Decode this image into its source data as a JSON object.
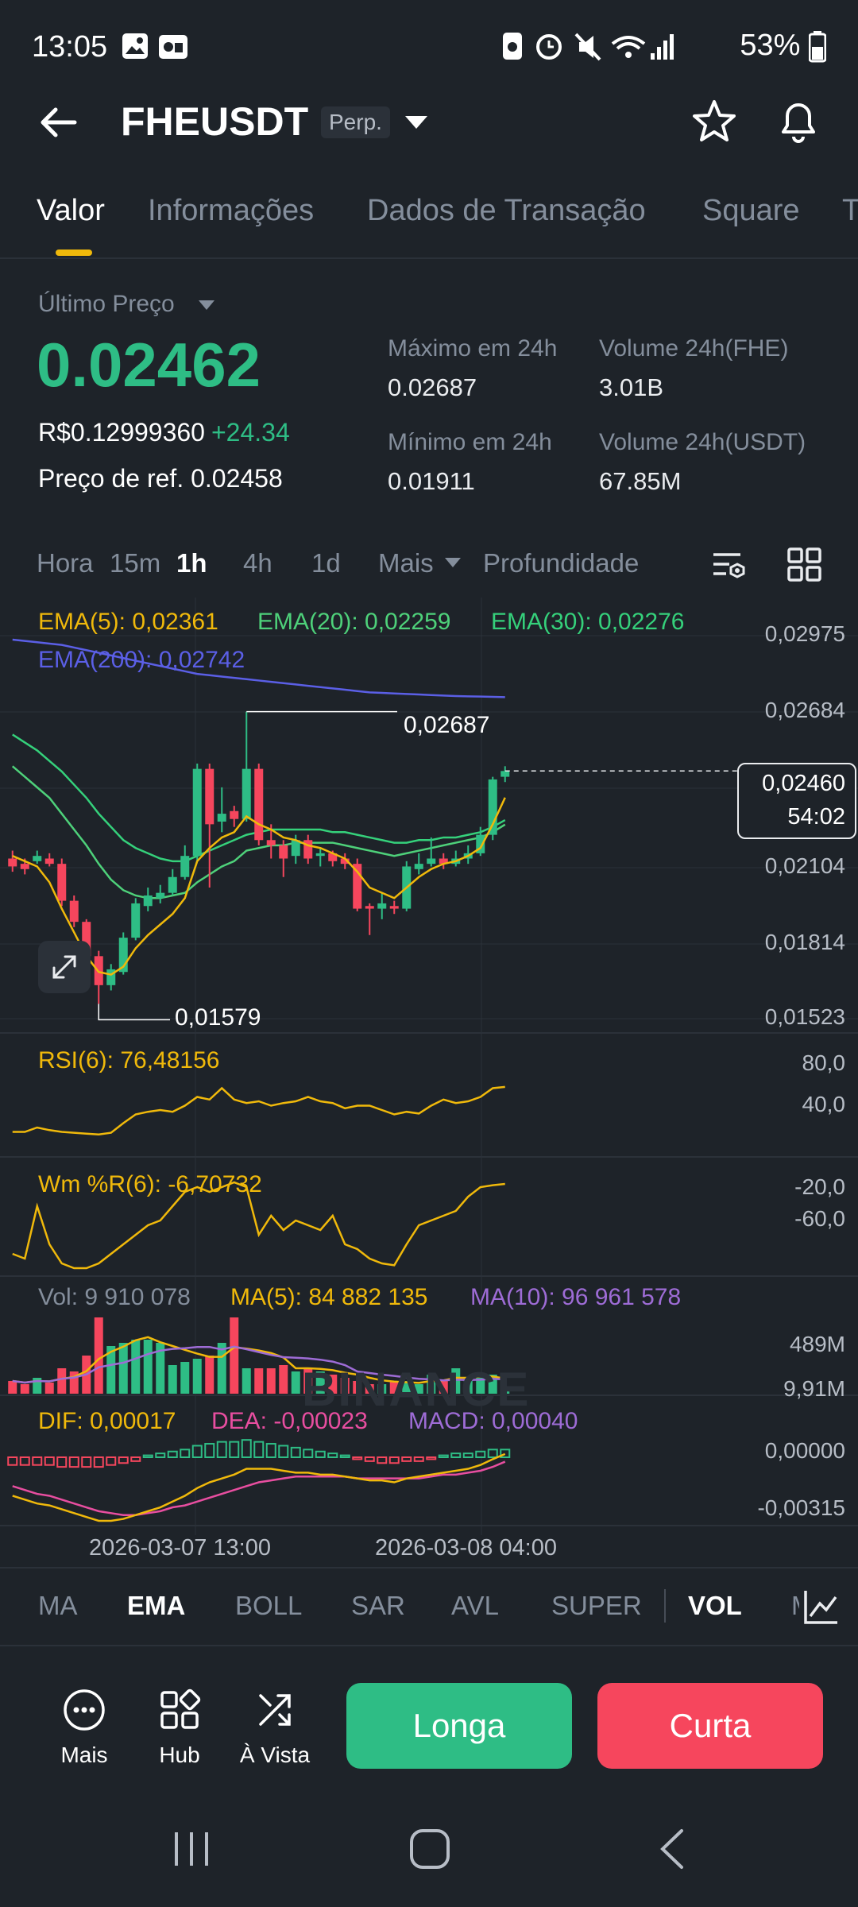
{
  "status_bar": {
    "time": "13:05",
    "battery": "53%"
  },
  "header": {
    "symbol": "FHEUSDT",
    "badge": "Perp."
  },
  "tabs": [
    {
      "label": "Valor"
    },
    {
      "label": "Informações"
    },
    {
      "label": "Dados de Transação"
    },
    {
      "label": "Square"
    },
    {
      "label": "T"
    }
  ],
  "price": {
    "label": "Último Preço",
    "last": "0.02462",
    "fiat": "R$0.12999360",
    "change": "+24.34",
    "ref_label": "Preço de ref.",
    "ref_value": "0.02458"
  },
  "stats": {
    "high_label": "Máximo em 24h",
    "high_value": "0.02687",
    "vol_base_label": "Volume 24h(FHE)",
    "vol_base_value": "3.01B",
    "low_label": "Mínimo em 24h",
    "low_value": "0.01911",
    "vol_quote_label": "Volume 24h(USDT)",
    "vol_quote_value": "67.85M"
  },
  "intervals": [
    {
      "label": "Hora"
    },
    {
      "label": "15m"
    },
    {
      "label": "1h"
    },
    {
      "label": "4h"
    },
    {
      "label": "1d"
    },
    {
      "label": "Mais"
    },
    {
      "label": "Profundidade"
    }
  ],
  "chart": {
    "ema5": "EMA(5): 0,02361",
    "ema20": "EMA(20): 0,02259",
    "ema30": "EMA(30): 0,02276",
    "ema200": "EMA(200): 0,02742",
    "y_labels": [
      "0,02975",
      "0,02684",
      "0,02104",
      "0,01814",
      "0,01523"
    ],
    "high_marker": "0,02687",
    "low_marker": "0,01579",
    "current_price": "0,02460",
    "countdown": "54:02",
    "watermark": "BINANCE",
    "rsi_label": "RSI(6): 76,48156",
    "rsi_axis": [
      "80,0",
      "40,0"
    ],
    "wr_label": "Wm %R(6): -6,70732",
    "wr_axis": [
      "-20,0",
      "-60,0"
    ],
    "vol_label": "Vol: 9 910 078",
    "vol_ma5": "MA(5): 84 882 135",
    "vol_ma10": "MA(10): 96 961 578",
    "vol_axis": [
      "489M",
      "9,91M"
    ],
    "dif": "DIF: 0,00017",
    "dea": "DEA: -0,00023",
    "macd": "MACD: 0,00040",
    "macd_axis": [
      "0,00000",
      "-0,00315"
    ],
    "time_labels": [
      "2026-03-07 13:00",
      "2026-03-08 04:00"
    ],
    "colors": {
      "up": "#2ebd85",
      "down": "#f6465d",
      "ema5": "#f0b90b",
      "ema20": "#4ed17a",
      "ema30": "#35d17b",
      "ema200": "#5b5fe6",
      "ma10": "#9e6cd6"
    }
  },
  "chart_data": {
    "type": "candlestick",
    "title": "FHEUSDT",
    "interval": "1h",
    "ylim": [
      0.01523,
      0.02975
    ],
    "candles": [
      {
        "o": 0.0213,
        "c": 0.021,
        "h": 0.0216,
        "l": 0.0208
      },
      {
        "o": 0.0211,
        "c": 0.0209,
        "h": 0.0213,
        "l": 0.0207
      },
      {
        "o": 0.0212,
        "c": 0.0214,
        "h": 0.0216,
        "l": 0.0211
      },
      {
        "o": 0.0213,
        "c": 0.0211,
        "h": 0.0215,
        "l": 0.021
      },
      {
        "o": 0.0211,
        "c": 0.0197,
        "h": 0.0213,
        "l": 0.0195
      },
      {
        "o": 0.0197,
        "c": 0.0189,
        "h": 0.0199,
        "l": 0.0187
      },
      {
        "o": 0.0189,
        "c": 0.0176,
        "h": 0.019,
        "l": 0.0174
      },
      {
        "o": 0.0176,
        "c": 0.0165,
        "h": 0.0178,
        "l": 0.01579
      },
      {
        "o": 0.0165,
        "c": 0.0171,
        "h": 0.0173,
        "l": 0.0163
      },
      {
        "o": 0.017,
        "c": 0.0183,
        "h": 0.0185,
        "l": 0.0169
      },
      {
        "o": 0.0183,
        "c": 0.0196,
        "h": 0.0198,
        "l": 0.0182
      },
      {
        "o": 0.0195,
        "c": 0.0199,
        "h": 0.0202,
        "l": 0.0193
      },
      {
        "o": 0.0198,
        "c": 0.02,
        "h": 0.0203,
        "l": 0.0196
      },
      {
        "o": 0.02,
        "c": 0.0206,
        "h": 0.0209,
        "l": 0.0199
      },
      {
        "o": 0.0206,
        "c": 0.0214,
        "h": 0.0218,
        "l": 0.0205
      },
      {
        "o": 0.0214,
        "c": 0.0247,
        "h": 0.0249,
        "l": 0.0212
      },
      {
        "o": 0.0247,
        "c": 0.0226,
        "h": 0.0249,
        "l": 0.0202
      },
      {
        "o": 0.0227,
        "c": 0.023,
        "h": 0.024,
        "l": 0.0223
      },
      {
        "o": 0.0231,
        "c": 0.0228,
        "h": 0.0233,
        "l": 0.0225
      },
      {
        "o": 0.0228,
        "c": 0.0247,
        "h": 0.02687,
        "l": 0.0227
      },
      {
        "o": 0.0247,
        "c": 0.022,
        "h": 0.0249,
        "l": 0.0218
      },
      {
        "o": 0.022,
        "c": 0.0218,
        "h": 0.0226,
        "l": 0.0213
      },
      {
        "o": 0.0218,
        "c": 0.0213,
        "h": 0.022,
        "l": 0.0206
      },
      {
        "o": 0.0214,
        "c": 0.022,
        "h": 0.0222,
        "l": 0.0211
      },
      {
        "o": 0.022,
        "c": 0.0213,
        "h": 0.0222,
        "l": 0.0211
      },
      {
        "o": 0.0214,
        "c": 0.0215,
        "h": 0.0217,
        "l": 0.021
      },
      {
        "o": 0.0215,
        "c": 0.0212,
        "h": 0.0216,
        "l": 0.021
      },
      {
        "o": 0.0213,
        "c": 0.0211,
        "h": 0.0215,
        "l": 0.0209
      },
      {
        "o": 0.0211,
        "c": 0.0194,
        "h": 0.0213,
        "l": 0.0193
      },
      {
        "o": 0.0195,
        "c": 0.0194,
        "h": 0.0196,
        "l": 0.0184
      },
      {
        "o": 0.0194,
        "c": 0.0196,
        "h": 0.02,
        "l": 0.019
      },
      {
        "o": 0.0195,
        "c": 0.0194,
        "h": 0.0197,
        "l": 0.0192
      },
      {
        "o": 0.0194,
        "c": 0.021,
        "h": 0.0212,
        "l": 0.0193
      },
      {
        "o": 0.0209,
        "c": 0.0211,
        "h": 0.0215,
        "l": 0.0207
      },
      {
        "o": 0.0211,
        "c": 0.0213,
        "h": 0.0221,
        "l": 0.021
      },
      {
        "o": 0.0213,
        "c": 0.0211,
        "h": 0.0215,
        "l": 0.0209
      },
      {
        "o": 0.0211,
        "c": 0.0213,
        "h": 0.0216,
        "l": 0.021
      },
      {
        "o": 0.0213,
        "c": 0.0215,
        "h": 0.0218,
        "l": 0.0211
      },
      {
        "o": 0.0215,
        "c": 0.0222,
        "h": 0.0225,
        "l": 0.0214
      },
      {
        "o": 0.0222,
        "c": 0.0243,
        "h": 0.0244,
        "l": 0.022
      },
      {
        "o": 0.0244,
        "c": 0.02462,
        "h": 0.0248,
        "l": 0.0242
      }
    ],
    "ema5": [
      0.0214,
      0.0212,
      0.021,
      0.0204,
      0.0194,
      0.0185,
      0.0176,
      0.017,
      0.0169,
      0.0172,
      0.0179,
      0.0184,
      0.0188,
      0.0192,
      0.0198,
      0.0212,
      0.0217,
      0.0221,
      0.0223,
      0.0229,
      0.0226,
      0.0224,
      0.0221,
      0.022,
      0.0218,
      0.0217,
      0.0215,
      0.0213,
      0.0208,
      0.0202,
      0.02,
      0.0198,
      0.0202,
      0.0206,
      0.0209,
      0.0211,
      0.0212,
      0.0214,
      0.0217,
      0.0226,
      0.02361
    ],
    "ema20": [
      0.0248,
      0.0244,
      0.024,
      0.0236,
      0.023,
      0.0224,
      0.0218,
      0.0211,
      0.0205,
      0.0201,
      0.0199,
      0.0198,
      0.0198,
      0.0199,
      0.02,
      0.0204,
      0.0207,
      0.021,
      0.0212,
      0.0216,
      0.0217,
      0.0218,
      0.0218,
      0.0219,
      0.0219,
      0.0219,
      0.0219,
      0.0218,
      0.0217,
      0.0216,
      0.0215,
      0.0214,
      0.0215,
      0.0216,
      0.0217,
      0.0218,
      0.0219,
      0.022,
      0.0221,
      0.0223,
      0.02259
    ],
    "ema30": [
      0.026,
      0.0257,
      0.0254,
      0.025,
      0.0246,
      0.0241,
      0.0236,
      0.023,
      0.0225,
      0.022,
      0.0217,
      0.0215,
      0.0213,
      0.0212,
      0.0212,
      0.0214,
      0.0216,
      0.0218,
      0.022,
      0.0222,
      0.0223,
      0.0224,
      0.0224,
      0.0224,
      0.0224,
      0.0224,
      0.0223,
      0.0223,
      0.0222,
      0.0221,
      0.022,
      0.0219,
      0.0219,
      0.022,
      0.022,
      0.0221,
      0.0221,
      0.0222,
      0.0223,
      0.0225,
      0.02276
    ],
    "ema200": [
      0.0296,
      0.02955,
      0.0295,
      0.02945,
      0.0294,
      0.0293,
      0.0292,
      0.0291,
      0.029,
      0.0289,
      0.0288,
      0.0287,
      0.0286,
      0.0285,
      0.0284,
      0.0283,
      0.02825,
      0.0282,
      0.02815,
      0.0281,
      0.02805,
      0.028,
      0.02795,
      0.0279,
      0.02785,
      0.0278,
      0.02775,
      0.0277,
      0.02765,
      0.0276,
      0.02758,
      0.02756,
      0.02754,
      0.02752,
      0.0275,
      0.02748,
      0.02746,
      0.02745,
      0.02744,
      0.02743,
      0.02742
    ],
    "rsi6": [
      25,
      25,
      30,
      27,
      25,
      24,
      23,
      22,
      24,
      35,
      45,
      48,
      50,
      48,
      55,
      65,
      62,
      75,
      62,
      58,
      60,
      55,
      58,
      60,
      65,
      60,
      58,
      52,
      55,
      55,
      50,
      45,
      48,
      46,
      55,
      62,
      58,
      60,
      65,
      75,
      76.48
    ],
    "wr6": [
      -80,
      -85,
      -30,
      -70,
      -90,
      -95,
      -95,
      -90,
      -80,
      -70,
      -60,
      -50,
      -45,
      -30,
      -15,
      -10,
      -15,
      -10,
      -5,
      -10,
      -60,
      -40,
      -55,
      -45,
      -50,
      -55,
      -40,
      -70,
      -75,
      -85,
      -90,
      -92,
      -70,
      -50,
      -45,
      -40,
      -35,
      -20,
      -10,
      -8,
      -6.71
    ],
    "volume": [
      40,
      30,
      50,
      35,
      80,
      70,
      120,
      240,
      150,
      160,
      170,
      170,
      160,
      90,
      100,
      110,
      120,
      160,
      240,
      80,
      80,
      80,
      90,
      70,
      80,
      70,
      60,
      50,
      40,
      30,
      30,
      40,
      40,
      30,
      60,
      40,
      80,
      40,
      50,
      60,
      9.91
    ],
    "macd_hist": [
      -0.0004,
      -0.0004,
      -0.0004,
      -0.0004,
      -0.0005,
      -0.0005,
      -0.0005,
      -0.0005,
      -0.0004,
      -0.0003,
      -0.0002,
      0.0001,
      0.0002,
      0.0003,
      0.0004,
      0.0006,
      0.0007,
      0.0008,
      0.0008,
      0.0009,
      0.0008,
      0.0007,
      0.0006,
      0.0005,
      0.0004,
      0.0003,
      0.0002,
      0.0001,
      -0.0001,
      -0.0002,
      -0.0003,
      -0.0003,
      -0.0002,
      -0.0002,
      -0.0001,
      0.0001,
      0.0002,
      0.0002,
      0.0003,
      0.0004,
      0.0004
    ],
    "dif": [
      -0.002,
      -0.0022,
      -0.0024,
      -0.0025,
      -0.0027,
      -0.0029,
      -0.0031,
      -0.0033,
      -0.0033,
      -0.0032,
      -0.003,
      -0.0028,
      -0.0026,
      -0.0023,
      -0.002,
      -0.0016,
      -0.0013,
      -0.0011,
      -0.0009,
      -0.0006,
      -0.0006,
      -0.0006,
      -0.0007,
      -0.0008,
      -0.0008,
      -0.0009,
      -0.0009,
      -0.001,
      -0.0011,
      -0.0012,
      -0.0012,
      -0.0013,
      -0.0011,
      -0.001,
      -0.0009,
      -0.0008,
      -0.0007,
      -0.0006,
      -0.0004,
      -0.0001,
      0.00017
    ],
    "dea": [
      -0.0015,
      -0.0017,
      -0.0019,
      -0.002,
      -0.0022,
      -0.0024,
      -0.0026,
      -0.0028,
      -0.0029,
      -0.003,
      -0.003,
      -0.0029,
      -0.0028,
      -0.0026,
      -0.0025,
      -0.0023,
      -0.0021,
      -0.0019,
      -0.0017,
      -0.0015,
      -0.0013,
      -0.0012,
      -0.0011,
      -0.001,
      -0.001,
      -0.001,
      -0.001,
      -0.001,
      -0.0011,
      -0.0011,
      -0.0011,
      -0.0011,
      -0.0011,
      -0.0011,
      -0.001,
      -0.0009,
      -0.0009,
      -0.0008,
      -0.0007,
      -0.0005,
      -0.00023
    ]
  },
  "indicators": [
    {
      "label": "MA"
    },
    {
      "label": "EMA"
    },
    {
      "label": "BOLL"
    },
    {
      "label": "SAR"
    },
    {
      "label": "AVL"
    },
    {
      "label": "SUPER"
    },
    {
      "label": "VOL"
    },
    {
      "label": "M"
    }
  ],
  "actions": {
    "more": "Mais",
    "hub": "Hub",
    "spot": "À Vista",
    "long": "Longa",
    "short": "Curta"
  }
}
